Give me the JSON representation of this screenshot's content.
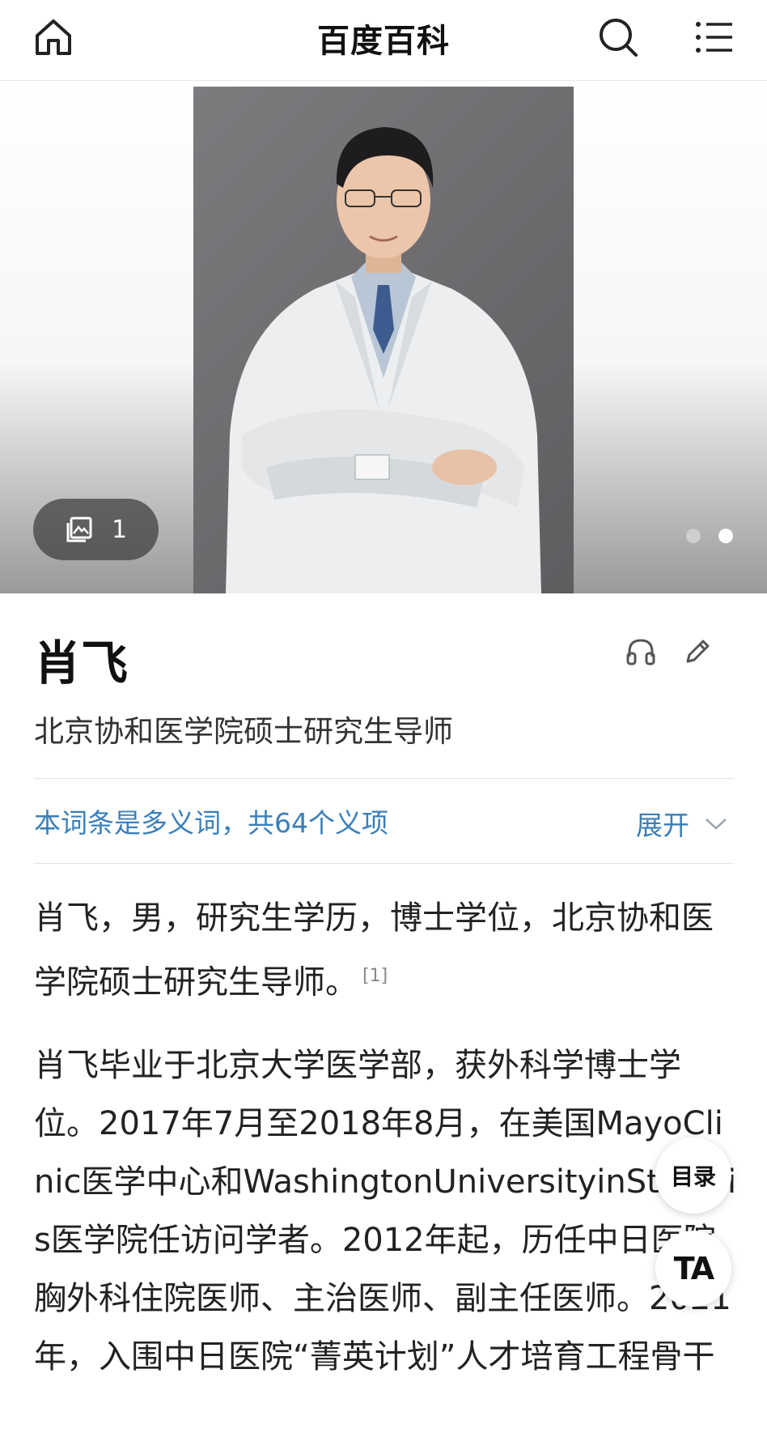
{
  "header": {
    "title": "百度百科"
  },
  "icons": {
    "home": "home-icon",
    "search": "search-icon",
    "menu": "menu-icon",
    "gallery": "gallery-icon",
    "listen": "headphones-icon",
    "edit": "pencil-icon",
    "chevron": "chevron-down-icon"
  },
  "hero": {
    "image_count": "1",
    "slide_count": 2,
    "active_slide": 2
  },
  "entry": {
    "title": "肖飞",
    "subtitle": "北京协和医学院硕士研究生导师"
  },
  "polysemy": {
    "text": "本词条是多义词，共64个义项",
    "expand_label": "展开"
  },
  "content": {
    "para1": "肖飞，男，研究生学历，博士学位，北京协和医学院硕士研究生导师。",
    "para1_ref": "[1]",
    "para2": "肖飞毕业于北京大学医学部，获外科学博士学位。2017年7月至2018年8月，在美国MayoClinic医学中心和WashingtonUniversityinSt.Louis医学院任访问学者。2012年起，历任中日医院胸外科住院医师、主治医师、副主任医师。2021年，入围中日医院“菁英计划”人才培育工程骨干"
  },
  "floating": {
    "toc_label": "目录",
    "ta_label": "TA"
  },
  "colors": {
    "link": "#3a7fb8",
    "text": "#222222",
    "badge_bg": "#3c3c3c"
  }
}
